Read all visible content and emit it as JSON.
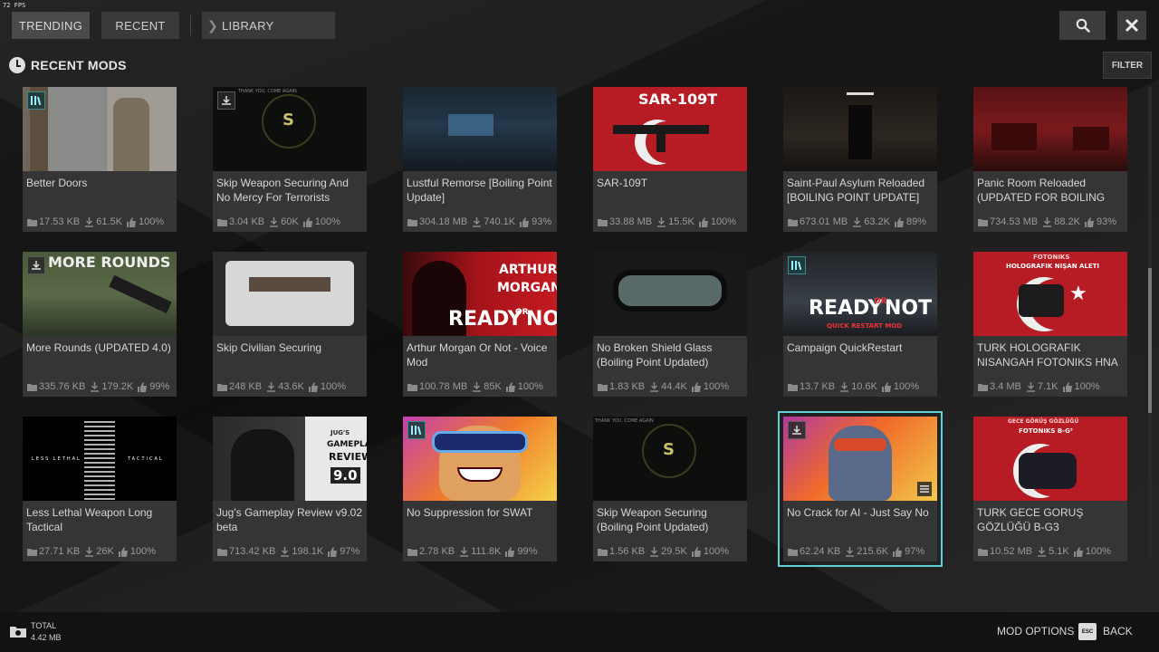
{
  "fps": "72 FPS",
  "tabs": {
    "trending": "TRENDING",
    "recent": "RECENT",
    "library": "LIBRARY"
  },
  "section_title": "RECENT MODS",
  "filter_label": "FILTER",
  "mods": [
    {
      "title": "Better Doors",
      "size": "17.53 KB",
      "downloads": "61.5K",
      "rating": "100%",
      "badge": "library"
    },
    {
      "title": "Skip Weapon Securing And No Mercy For Terrorists",
      "size": "3.04 KB",
      "downloads": "60K",
      "rating": "100%",
      "badge": "download"
    },
    {
      "title": "Lustful Remorse [Boiling Point Update]",
      "size": "304.18 MB",
      "downloads": "740.1K",
      "rating": "93%",
      "badge": ""
    },
    {
      "title": "SAR-109T",
      "size": "33.88 MB",
      "downloads": "15.5K",
      "rating": "100%",
      "badge": ""
    },
    {
      "title": "Saint-Paul Asylum Reloaded [BOILING POINT UPDATE]",
      "size": "673.01 MB",
      "downloads": "63.2K",
      "rating": "89%",
      "badge": ""
    },
    {
      "title": "Panic Room Reloaded (UPDATED FOR BOILING POINT)",
      "size": "734.53 MB",
      "downloads": "88.2K",
      "rating": "93%",
      "badge": ""
    },
    {
      "title": "More Rounds (UPDATED 4.0)",
      "size": "335.76 KB",
      "downloads": "179.2K",
      "rating": "99%",
      "badge": "download"
    },
    {
      "title": "Skip Civilian Securing",
      "size": "248 KB",
      "downloads": "43.6K",
      "rating": "100%",
      "badge": ""
    },
    {
      "title": "Arthur Morgan Or Not - Voice Mod",
      "size": "100.78 MB",
      "downloads": "85K",
      "rating": "100%",
      "badge": ""
    },
    {
      "title": "No Broken Shield Glass (Boiling Point Updated)",
      "size": "1.83 KB",
      "downloads": "44.4K",
      "rating": "100%",
      "badge": ""
    },
    {
      "title": "Campaign QuickRestart",
      "size": "13.7 KB",
      "downloads": "10.6K",
      "rating": "100%",
      "badge": "library"
    },
    {
      "title": "TURK HOLOGRAFIK NISANGAH FOTONIKS HNA",
      "size": "3.4 MB",
      "downloads": "7.1K",
      "rating": "100%",
      "badge": ""
    },
    {
      "title": "Less Lethal Weapon Long Tactical",
      "size": "27.71 KB",
      "downloads": "26K",
      "rating": "100%",
      "badge": ""
    },
    {
      "title": "Jug's Gameplay Review v9.02 beta",
      "size": "713.42 KB",
      "downloads": "198.1K",
      "rating": "97%",
      "badge": ""
    },
    {
      "title": "No Suppression for SWAT",
      "size": "2.78 KB",
      "downloads": "111.8K",
      "rating": "99%",
      "badge": "library"
    },
    {
      "title": "Skip Weapon Securing (Boiling Point Updated)",
      "size": "1.56 KB",
      "downloads": "29.5K",
      "rating": "100%",
      "badge": ""
    },
    {
      "title": "No Crack for AI - Just Say No",
      "size": "62.24 KB",
      "downloads": "215.6K",
      "rating": "97%",
      "badge": "download"
    },
    {
      "title": "TURK GECE GORUŞ GÖZLÜĞÜ B-G3",
      "size": "10.52 MB",
      "downloads": "5.1K",
      "rating": "100%",
      "badge": ""
    }
  ],
  "thumb_text": {
    "sar": "SAR-109T",
    "more_rounds": "MORE ROUNDS",
    "arthur": "ARTHUR",
    "morgan": "MORGAN",
    "ready": "READY",
    "or": "OR",
    "not": "NOT",
    "quick_restart": "QUICK RESTART MOD",
    "fotoniks": "FOTONIKS",
    "holografik": "HOLOGRAFIK NIŞAN ALETI",
    "less_lethal": "LESS LETHAL",
    "tactical": "TACTICAL",
    "jugs": "JUG'S",
    "gameplay": "GAMEPLAY",
    "review": "REVIEW",
    "version": "9.0",
    "thank_you": "THANK YOU, COME AGAIN",
    "s_letter": "S",
    "gece": "GECE GÖRÜŞ GÖZLÜĞÜ",
    "fotoniks_bg": "FOTONIKS B-G³"
  },
  "footer": {
    "total_label": "TOTAL",
    "total_value": "4.42 MB",
    "mod_options": "MOD OPTIONS",
    "esc_key": "ESC",
    "back": "BACK"
  },
  "colors": {
    "accent": "#5fd0d6",
    "card_bg": "#353535",
    "footer_bg": "#121212"
  }
}
